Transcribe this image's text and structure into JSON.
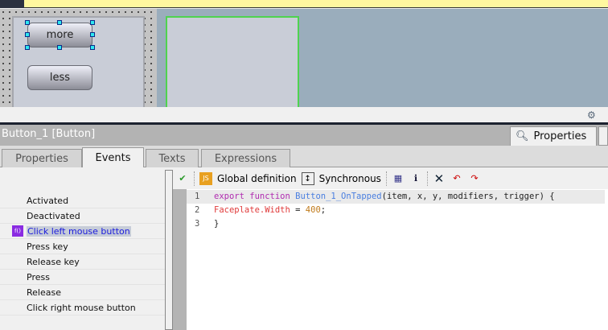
{
  "canvas": {
    "buttons": [
      "more",
      "less"
    ]
  },
  "inspector": {
    "title": "Button_1 [Button]",
    "side_tab": "Properties"
  },
  "tabs": [
    "Properties",
    "Events",
    "Texts",
    "Expressions"
  ],
  "events": [
    "Activated",
    "Deactivated",
    "Click left mouse button",
    "Press key",
    "Release key",
    "Press",
    "Release",
    "Click right mouse button"
  ],
  "selected_event": "Click left mouse button",
  "toolbar": {
    "global_definition": "Global definition",
    "synchronous": "Synchronous"
  },
  "code": {
    "lines": [
      {
        "n": "1",
        "parts": [
          [
            "export function ",
            "#b02cb0"
          ],
          [
            "Button_1_OnTapped",
            "#4a7fe0"
          ],
          [
            "(item, x, y, modifiers, trigger) {",
            "#222"
          ]
        ]
      },
      {
        "n": "2",
        "parts": [
          [
            "Faceplate.Width",
            "#e03a3a"
          ],
          [
            " = ",
            "#222"
          ],
          [
            "400",
            "#c07a1a"
          ],
          [
            ";",
            "#222"
          ]
        ]
      },
      {
        "n": "3",
        "parts": [
          [
            "}",
            "#222"
          ]
        ]
      }
    ]
  }
}
